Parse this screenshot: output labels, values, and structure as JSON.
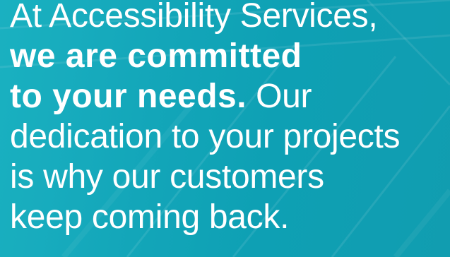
{
  "banner": {
    "lines": {
      "l1": "At Accessibility Services,",
      "l2": "we are committed",
      "l3_bold": "to your needs.",
      "l3_rest": " Our",
      "l4": "dedication to your projects",
      "l5": "is why our customers",
      "l6": "keep coming back."
    },
    "colors": {
      "background": "#14a9bb",
      "text": "#ffffff"
    }
  }
}
